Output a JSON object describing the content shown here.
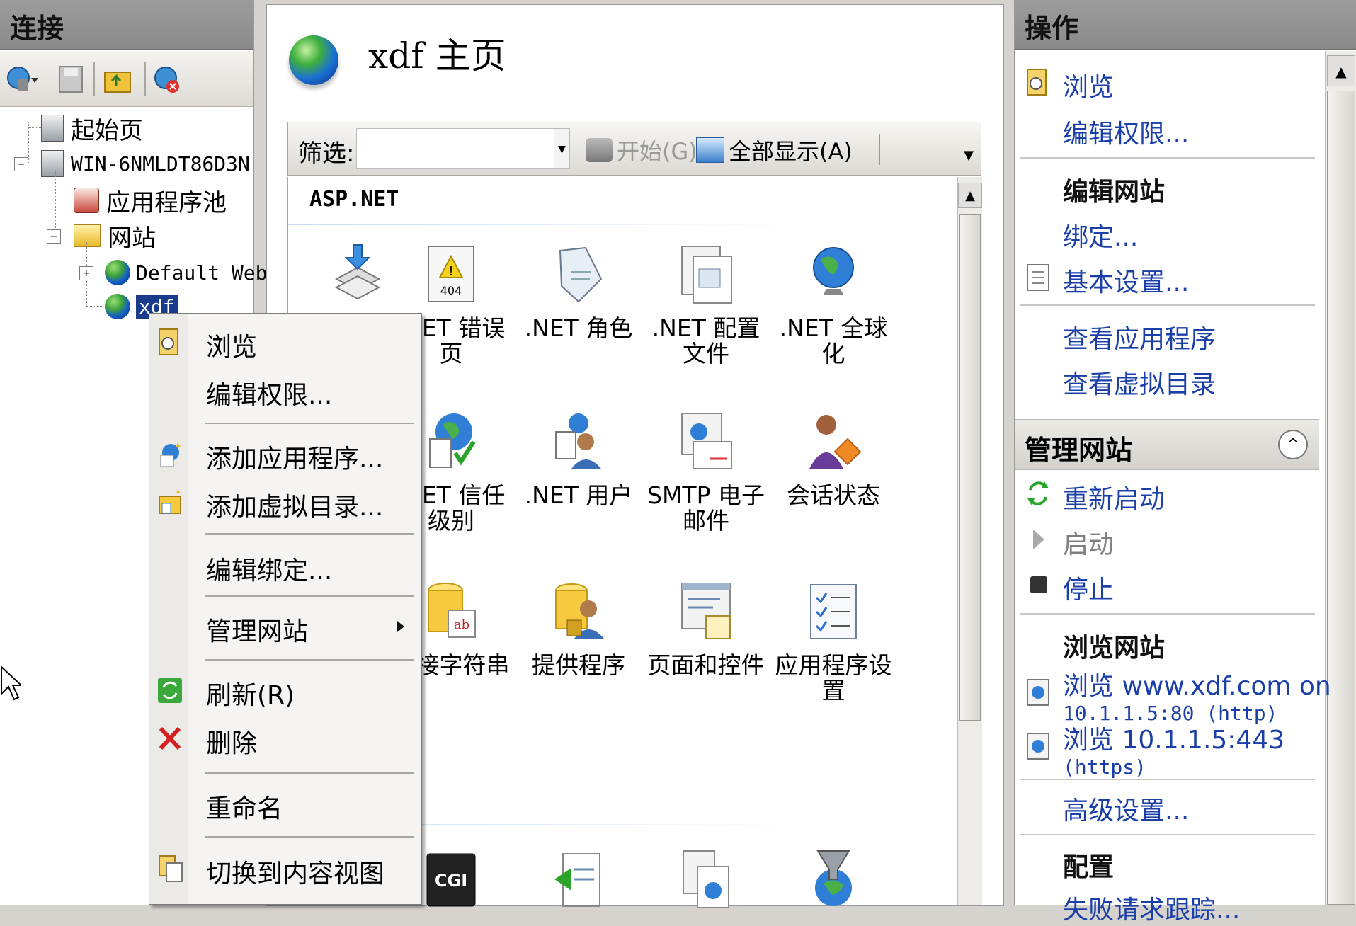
{
  "left_panel": {
    "title": "连接",
    "tree": {
      "start_page": "起始页",
      "server": "WIN-6NMLDT86D3N (",
      "app_pools": "应用程序池",
      "sites": "网站",
      "default_site": "Default Web",
      "site_xdf": "xdf"
    }
  },
  "center": {
    "page_title": "xdf 主页",
    "filter": {
      "label": "筛选:",
      "value": "",
      "go_label": "开始(G)",
      "show_all_label": "全部显示(A)"
    },
    "group_header": "ASP.NET",
    "features": {
      "net_error_pages": ".NET 错误页",
      "net_roles": ".NET 角色",
      "net_profile": ".NET 配置文件",
      "net_globalization": ".NET 全球化",
      "net_trust_levels": ".NET 信任级别",
      "net_users": ".NET 用户",
      "smtp_email": "SMTP 电子邮件",
      "session_state": "会话状态",
      "connection_strings": "连接字符串",
      "providers": "提供程序",
      "pages_controls": "页面和控件",
      "app_settings": "应用程序设置",
      "cgi_label": "CGI"
    }
  },
  "context_menu": {
    "browse": "浏览",
    "edit_permissions": "编辑权限...",
    "add_application": "添加应用程序...",
    "add_virtual_dir": "添加虚拟目录...",
    "edit_bindings": "编辑绑定...",
    "manage_site": "管理网站",
    "refresh": "刷新(R)",
    "delete": "删除",
    "rename": "重命名",
    "switch_content_view": "切换到内容视图"
  },
  "actions": {
    "title": "操作",
    "browse": "浏览",
    "edit_permissions": "编辑权限...",
    "edit_site_header": "编辑网站",
    "bindings": "绑定...",
    "basic_settings": "基本设置...",
    "view_apps": "查看应用程序",
    "view_vdirs": "查看虚拟目录",
    "manage_site_header": "管理网站",
    "restart": "重新启动",
    "start": "启动",
    "stop": "停止",
    "browse_site_header": "浏览网站",
    "browse_http_1": "浏览 www.xdf.com on",
    "browse_http_2": "10.1.1.5:80 (http)",
    "browse_https_1": "浏览 10.1.1.5:443",
    "browse_https_2": "(https)",
    "advanced_settings": "高级设置...",
    "config_header": "配置",
    "failed_request_partial": "失败请求跟踪..."
  },
  "colors": {
    "link": "#1a3fa8",
    "header_bg": "#8a8a8a",
    "selection": "#1a3a8c"
  }
}
